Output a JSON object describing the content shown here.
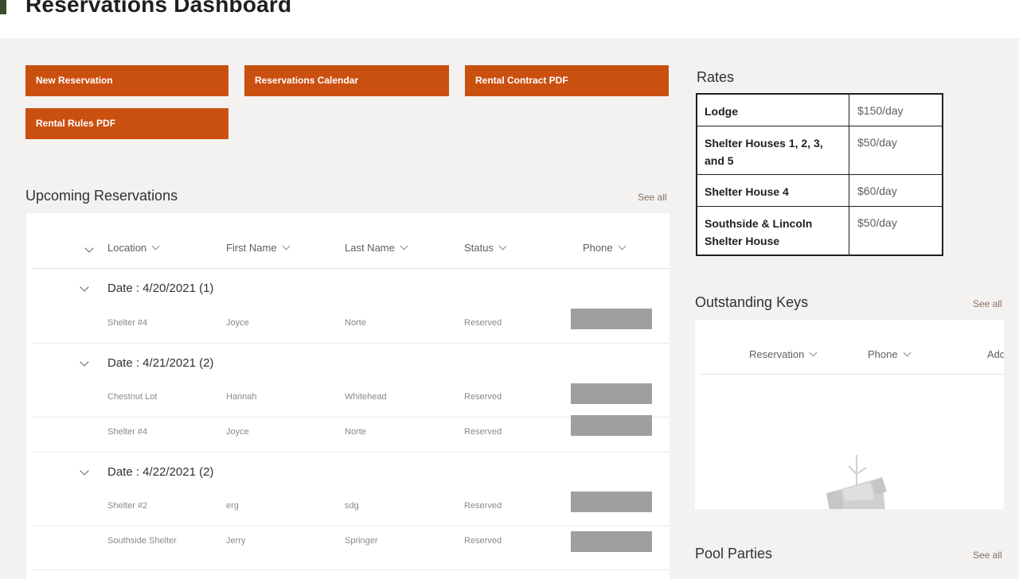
{
  "header": {
    "title": "Reservations Dashboard"
  },
  "buttons": {
    "new_reservation": "New Reservation",
    "calendar": "Reservations Calendar",
    "contract": "Rental Contract PDF",
    "rules": "Rental Rules PDF"
  },
  "upcoming": {
    "title": "Upcoming Reservations",
    "see_all": "See all",
    "columns": [
      "Location",
      "First Name",
      "Last Name",
      "Status",
      "Phone"
    ],
    "groups": [
      {
        "label": "Date : 4/20/2021 (1)",
        "rows": [
          {
            "location": "Shelter #4",
            "first": "Joyce",
            "last": "Norte",
            "status": "Reserved"
          }
        ]
      },
      {
        "label": "Date : 4/21/2021 (2)",
        "rows": [
          {
            "location": "Chestnut Lot",
            "first": "Hannah",
            "last": "Whitehead",
            "status": "Reserved"
          },
          {
            "location": "Shelter #4",
            "first": "Joyce",
            "last": "Norte",
            "status": "Reserved"
          }
        ]
      },
      {
        "label": "Date : 4/22/2021 (2)",
        "rows": [
          {
            "location": "Shelter #2",
            "first": "erg",
            "last": "sdg",
            "status": "Reserved"
          },
          {
            "location": "Southside Shelter",
            "first": "Jerry",
            "last": "Springer",
            "status": "Reserved"
          }
        ]
      }
    ]
  },
  "rates": {
    "title": "Rates",
    "rows": [
      {
        "name": "Lodge",
        "value": "$150/day"
      },
      {
        "name": "Shelter Houses 1, 2, 3, and 5",
        "value": "$50/day"
      },
      {
        "name": "Shelter House 4",
        "value": "$60/day"
      },
      {
        "name": "Southside & Lincoln Shelter House",
        "value": "$50/day"
      }
    ]
  },
  "keys": {
    "title": "Outstanding Keys",
    "see_all": "See all",
    "columns": [
      "Reservation",
      "Phone",
      "Add"
    ]
  },
  "pool": {
    "title": "Pool Parties",
    "see_all": "See all"
  },
  "colors": {
    "accent": "#ca5010",
    "background": "#f3f2f1",
    "redacted": "#a19f9d"
  },
  "icons": {
    "column_sort": "chevron-down-icon",
    "group_toggle": "chevron-down-icon",
    "empty_state": "empty-box-illustration"
  }
}
